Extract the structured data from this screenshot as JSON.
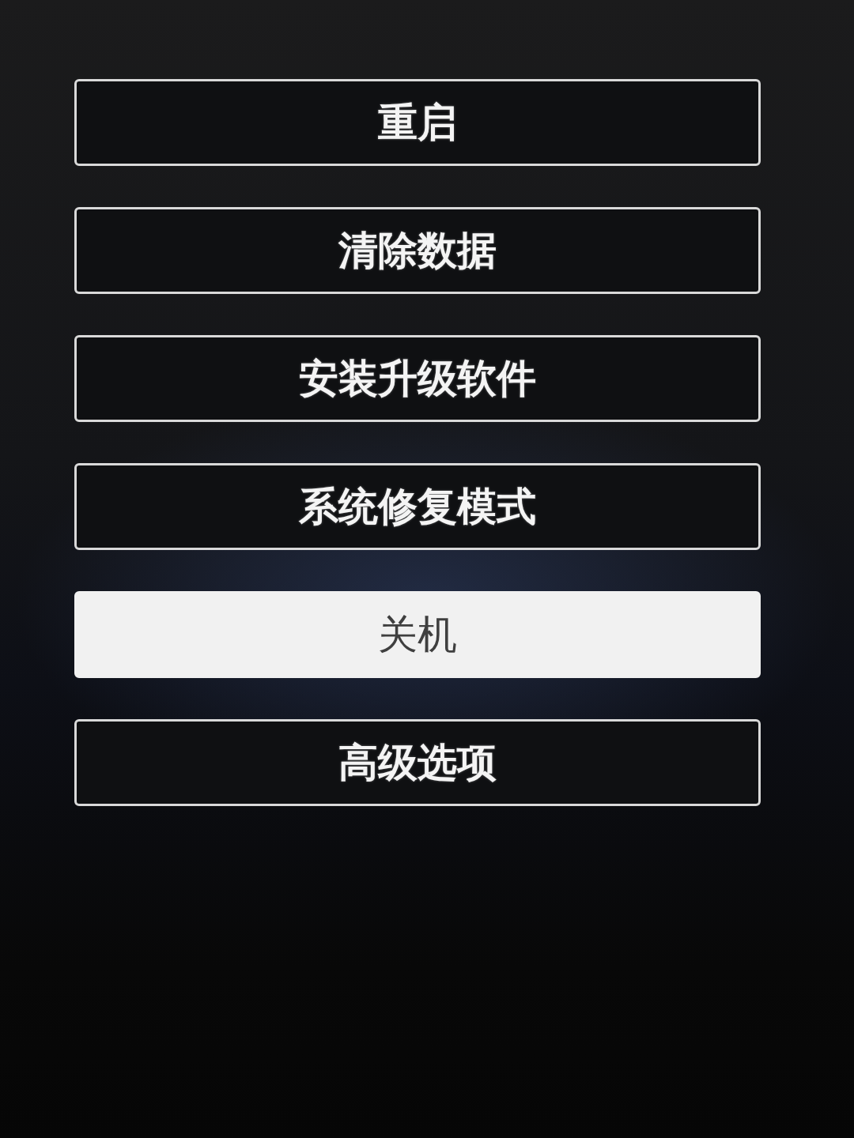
{
  "menu": {
    "items": [
      {
        "label": "重启",
        "selected": false
      },
      {
        "label": "清除数据",
        "selected": false
      },
      {
        "label": "安装升级软件",
        "selected": false
      },
      {
        "label": "系统修复模式",
        "selected": false
      },
      {
        "label": "关机",
        "selected": true
      },
      {
        "label": "高级选项",
        "selected": false
      }
    ]
  }
}
